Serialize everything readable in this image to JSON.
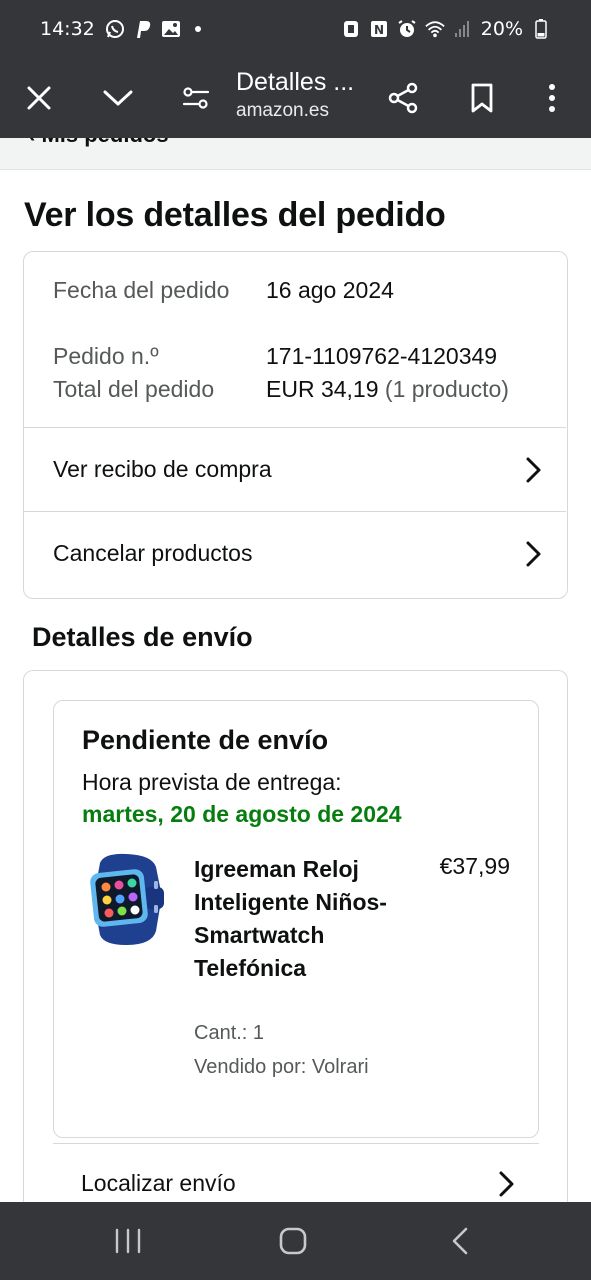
{
  "status_bar": {
    "time": "14:32",
    "battery": "20%"
  },
  "toolbar": {
    "title": "Detalles ...",
    "domain": "amazon.es"
  },
  "breadcrumb": "‹ Mis pedidos",
  "page_title": "Ver los detalles del pedido",
  "order_info": {
    "date_label": "Fecha del pedido",
    "date_value": "16 ago 2024",
    "number_label": "Pedido n.º",
    "number_value": "171-1109762-4120349",
    "total_label": "Total del pedido",
    "total_value": "EUR 34,19",
    "total_count": "(1 producto)"
  },
  "links": {
    "receipt": "Ver recibo de compra",
    "cancel": "Cancelar productos",
    "track": "Localizar envío"
  },
  "shipping": {
    "section_title": "Detalles de envío",
    "status": "Pendiente de envío",
    "eta_label": "Hora prevista de entrega:",
    "eta_date": "martes, 20 de agosto de 2024",
    "eta_color": "#067d0e"
  },
  "product": {
    "name": "Igreeman Reloj Inteligente Niños-Smartwatch Telefónica",
    "price": "€37,99",
    "qty": "Cant.: 1",
    "seller": "Vendido por: Volrari"
  },
  "colors": {
    "bar_bg": "#35363a",
    "border": "#d5d9d9",
    "muted_text": "#565959"
  }
}
